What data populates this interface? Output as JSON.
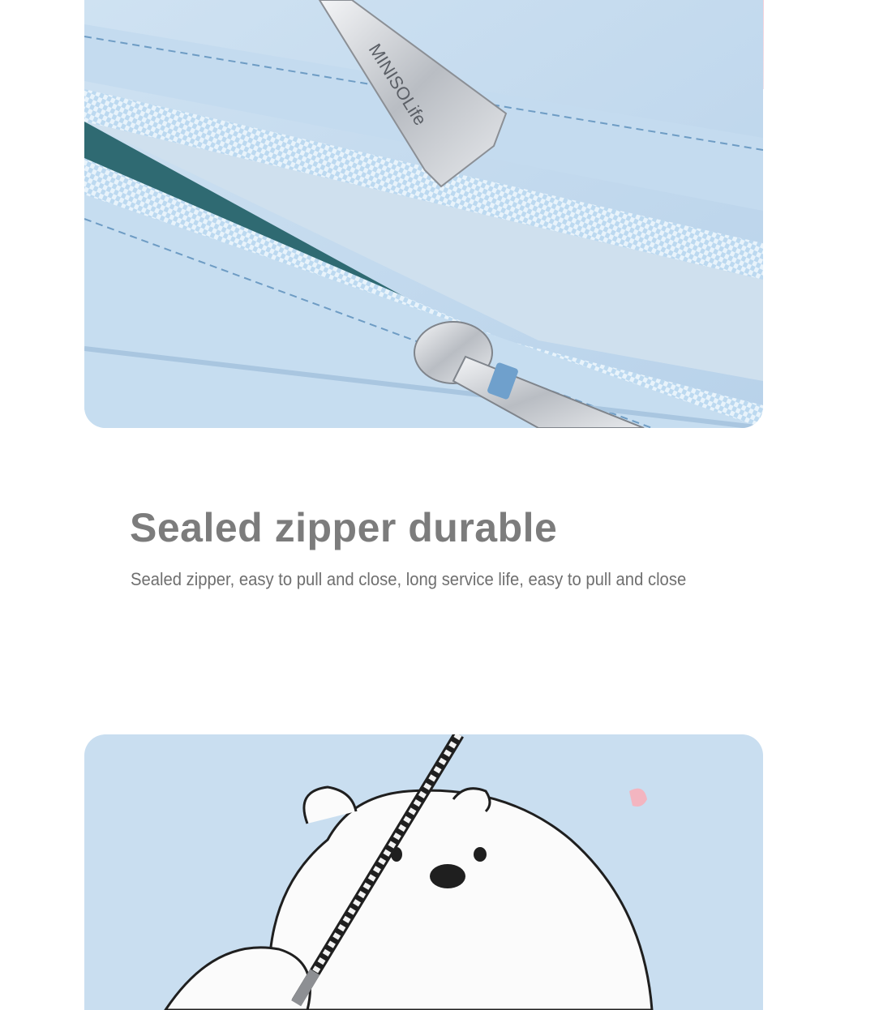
{
  "feature": {
    "title": "Sealed zipper durable",
    "description": "Sealed zipper, easy to pull and close, long service life, easy to pull and close"
  },
  "images": {
    "top": {
      "subject": "zipper-closeup-photo",
      "puller_brand_text": "MINISOLife"
    },
    "bottom": {
      "subject": "bear-print-photo"
    }
  },
  "colors": {
    "bag_blue": "#c9def0",
    "zipper_tape": "#b9d7ee",
    "lining_teal": "#2f6a72",
    "metal": "#cfd2d6",
    "title_gray": "#7c7c7c",
    "text_gray": "#6f6f6f",
    "accent_pink": "#f3c6cf"
  }
}
